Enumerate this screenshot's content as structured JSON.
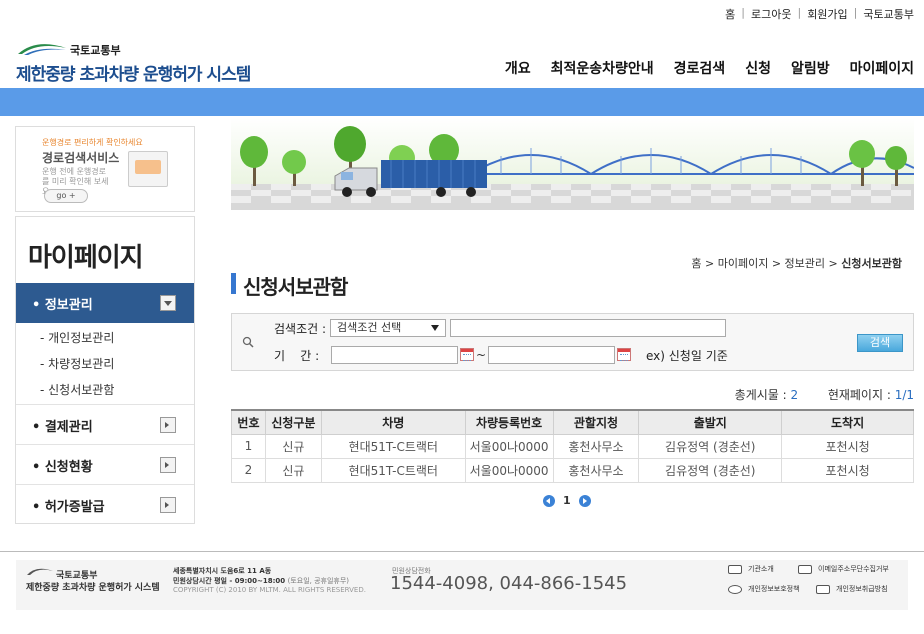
{
  "util_links": [
    "홈",
    "로그아웃",
    "회원가입",
    "국토교통부"
  ],
  "logo": {
    "ministry": "국토교통부",
    "system_name": "제한중량 초과차량 운행허가 시스템"
  },
  "gnb": [
    "개요",
    "최적운송차량안내",
    "경로검색",
    "신청",
    "알림방",
    "마이페이지"
  ],
  "ad": {
    "line1": "운행경로 편리하게 확인하세요",
    "line2": "경로검색서비스",
    "line3": "운행 전에 운행경로를 미리 확인해 보세요.",
    "go": "go +"
  },
  "lnb": {
    "title": "마이페이지",
    "active": "• 정보관리",
    "subs": [
      "- 개인정보관리",
      "- 차량정보관리",
      "- 신청서보관함"
    ],
    "menus": [
      "• 결제관리",
      "• 신청현황",
      "• 허가증발급"
    ]
  },
  "breadcrumb": {
    "path": "홈 > 마이페이지 > 정보관리 > ",
    "current": "신청서보관함"
  },
  "page_title": "신청서보관함",
  "search": {
    "criteria_label": "검색조건 :",
    "period_label": "기    간 :",
    "select_value": "검색조건 선택",
    "tilde": "~",
    "hint": "ex) 신청일 기준",
    "button": "검색"
  },
  "totals": {
    "total_label": "총게시물 : ",
    "total": "2",
    "page_label": "현재페이지 : ",
    "page": "1/1"
  },
  "table": {
    "headers": [
      "번호",
      "신청구분",
      "차명",
      "차량등록번호",
      "관할지청",
      "출발지",
      "도착지"
    ],
    "rows": [
      [
        "1",
        "신규",
        "현대51T-C트랙터",
        "서울00나0000",
        "홍천사무소",
        "김유정역 (경춘선)",
        "포천시청"
      ],
      [
        "2",
        "신규",
        "현대51T-C트랙터",
        "서울00나0000",
        "홍천사무소",
        "김유정역 (경춘선)",
        "포천시청"
      ]
    ]
  },
  "pager": {
    "current": "1"
  },
  "footer": {
    "logo1": "국토교통부",
    "logo2": "제한중량 초과차량 운행허가 시스템",
    "addr1": "세종특별자치시 도움6로 11 A동",
    "addr2": "민원상담시간 평일 - 09:00~18:00",
    "addr2_note": "(토요일, 공휴일휴무)",
    "addr3": "COPYRIGHT (C) 2010 BY MLTM. ALL RIGHTS RESERVED.",
    "tel_label": "민원상담전화",
    "tel": "1544-4098, 044-866-1545",
    "links": [
      "기관소개",
      "이메일주소무단수집거부",
      "개인정보보호정책",
      "개인정보취급방침"
    ]
  },
  "colors": {
    "brand_blue": "#5a9be8",
    "lnb_active": "#2d5a90",
    "accent": "#3677d0"
  }
}
